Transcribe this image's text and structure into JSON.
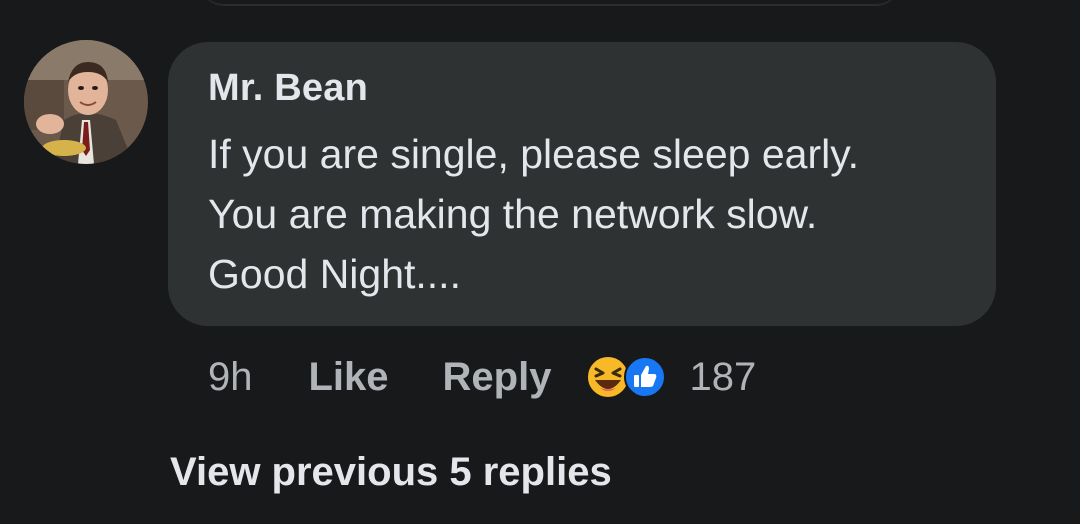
{
  "comment": {
    "author": "Mr. Bean",
    "text_lines": [
      "If you are single, please sleep early.",
      "You are making the network slow.",
      "Good Night...."
    ],
    "time": "9h",
    "like_label": "Like",
    "reply_label": "Reply",
    "reaction_count": "187",
    "reactions": [
      "haha-icon",
      "like-reaction-icon"
    ]
  },
  "replies": {
    "view_previous_label": "View previous 5 replies"
  },
  "colors": {
    "background": "#18191a",
    "bubble": "#2f3233",
    "primary_text": "#e4e6eb",
    "secondary_text": "#b0b3b8",
    "like_blue": "#1877f2",
    "haha_yellow": "#f7b928"
  }
}
